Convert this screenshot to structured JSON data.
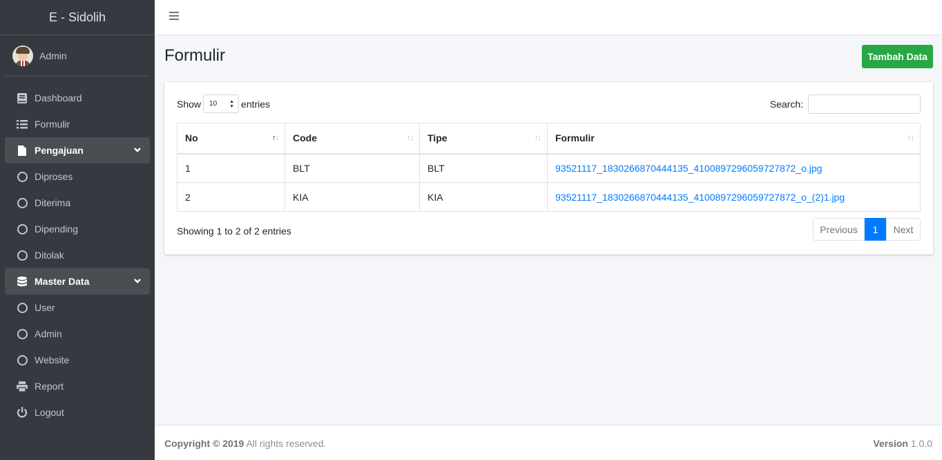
{
  "brand": "E - Sidolih",
  "user": {
    "name": "Admin"
  },
  "sidebar": {
    "items": [
      {
        "label": "Dashboard"
      },
      {
        "label": "Formulir"
      },
      {
        "label": "Pengajuan"
      },
      {
        "label": "Diproses"
      },
      {
        "label": "Diterima"
      },
      {
        "label": "Dipending"
      },
      {
        "label": "Ditolak"
      },
      {
        "label": "Master Data"
      },
      {
        "label": "User"
      },
      {
        "label": "Admin"
      },
      {
        "label": "Website"
      },
      {
        "label": "Report"
      },
      {
        "label": "Logout"
      }
    ]
  },
  "page": {
    "title": "Formulir",
    "add_button": "Tambah Data"
  },
  "table": {
    "show_label": "Show",
    "entries_label": "entries",
    "length_value": "10",
    "search_label": "Search:",
    "search_value": "",
    "columns": [
      "No",
      "Code",
      "Tipe",
      "Formulir"
    ],
    "rows": [
      [
        "1",
        "BLT",
        "BLT",
        "93521117_1830266870444135_4100897296059727872_o.jpg"
      ],
      [
        "2",
        "KIA",
        "KIA",
        "93521117_1830266870444135_4100897296059727872_o_(2)1.jpg"
      ]
    ],
    "info": "Showing 1 to 2 of 2 entries",
    "pagination": {
      "previous": "Previous",
      "current": "1",
      "next": "Next"
    }
  },
  "footer": {
    "copyright": "Copyright © 2019",
    "rights": " All rights reserved.",
    "version_label": "Version",
    "version": " 1.0.0"
  },
  "colors": {
    "sidebar": "#343a40",
    "success": "#28a745",
    "primary": "#007bff"
  }
}
